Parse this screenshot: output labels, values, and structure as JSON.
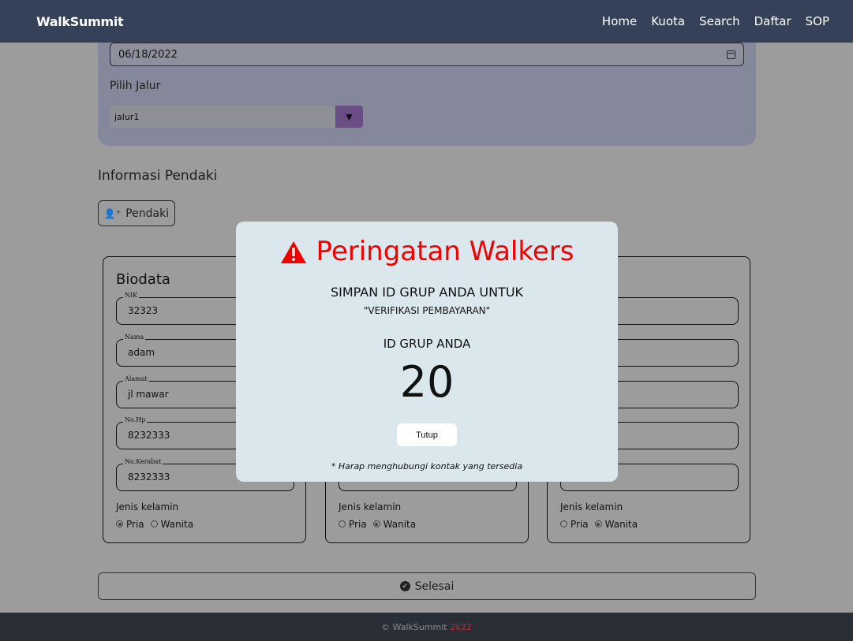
{
  "navbar": {
    "brand": "WalkSummit",
    "links": [
      "Home",
      "Kuota",
      "Search",
      "Daftar",
      "SOP"
    ]
  },
  "form": {
    "date_value": "06/18/2022",
    "jalur_label": "Pilih Jalur",
    "jalur_value": "jalur1"
  },
  "climbers": {
    "section_title": "Informasi Pendaki",
    "add_button": "Pendaki",
    "cards": [
      {
        "title": "Biodata",
        "fields": [
          {
            "label": "NIK",
            "value": "32323"
          },
          {
            "label": "Nama",
            "value": "adam"
          },
          {
            "label": "Alamat",
            "value": "jl mawar"
          },
          {
            "label": "No.Hp",
            "value": "8232333"
          },
          {
            "label": "No.Kerabat",
            "value": "8232333"
          }
        ],
        "gender_label": "Jenis kelamin",
        "gender_options": [
          "Pria",
          "Wanita"
        ],
        "gender_selected": "Pria"
      },
      {
        "title": "",
        "fields": [],
        "gender_label": "Jenis kelamin",
        "gender_options": [
          "Pria",
          "Wanita"
        ],
        "gender_selected": "Wanita"
      },
      {
        "title": "",
        "fields": [],
        "gender_label": "Jenis kelamin",
        "gender_options": [
          "Pria",
          "Wanita"
        ],
        "gender_selected": "Wanita"
      }
    ]
  },
  "finish_button": "Selesai",
  "footer": {
    "text": "© WalkSummit",
    "year": "2k22"
  },
  "modal": {
    "title": "Peringatan Walkers",
    "line1": "SIMPAN ID GRUP ANDA UNTUK",
    "line2": "\"VERIFIKASI PEMBAYARAN\"",
    "line3": "ID GRUP ANDA",
    "group_id": "20",
    "close_button": "Tutup",
    "note": "* Harap menghubungi kontak yang tersedia"
  },
  "colors": {
    "navbar": "#344158",
    "modal_bg": "#dae8ed",
    "title_red": "#f20000",
    "select_accent": "#6b4e86"
  }
}
